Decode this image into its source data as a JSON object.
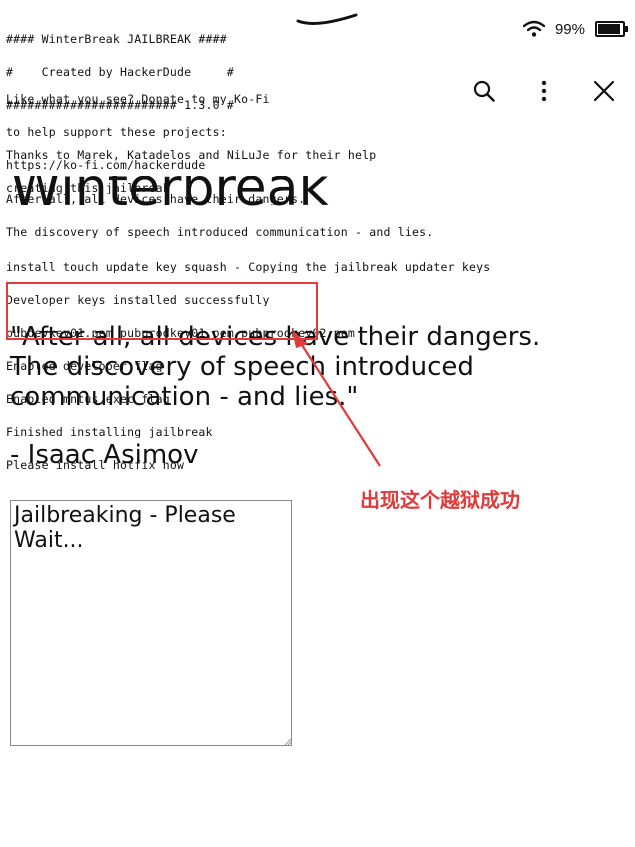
{
  "terminal": {
    "banner": [
      "#### WinterBreak JAILBREAK ####",
      "#    Created by HackerDude     #",
      "######################## 1.3.0 #"
    ],
    "donate": [
      "Like what you see? Donate to my Ko-Fi",
      "to help support these projects:",
      "https://ko-fi.com/hackerdude"
    ],
    "thanks": [
      "Thanks to Marek, Katadelos and NiLuJe for their help",
      "creating this jailbreak"
    ],
    "quote": [
      "After all, all devices have their dangers.",
      "The discovery of speech introduced communication - and lies."
    ],
    "install_log": [
      "install_touch_update_key_squash - Copying the jailbreak updater keys",
      "Developer keys installed successfully",
      "pubdevkey01.pem pubprodkey01.pem pubprodkey02.pem",
      "Enabled developer flag",
      "Enabled mntus exec flag",
      "Finished installing jailbreak",
      "Please install hotfix now"
    ]
  },
  "status_bar": {
    "battery_text": "99%",
    "battery_level": 0.99,
    "icons": [
      "wifi-icon",
      "battery-icon"
    ]
  },
  "toolbar": {
    "icons": [
      "search-icon",
      "more-vertical-icon",
      "close-icon"
    ]
  },
  "page": {
    "title": "Winterbreak",
    "quote_lines": [
      "\"After all, all devices have their dangers.",
      "The discovery of speech introduced",
      "communication - and lies.\""
    ],
    "author": "- Isaac Asimov",
    "status_box_text": "Jailbreaking - Please Wait..."
  },
  "annotation": {
    "text": "出现这个越狱成功",
    "color": "#e03a3a"
  },
  "colors": {
    "highlight": "#e03a3a",
    "text": "#111111",
    "background": "#ffffff"
  }
}
